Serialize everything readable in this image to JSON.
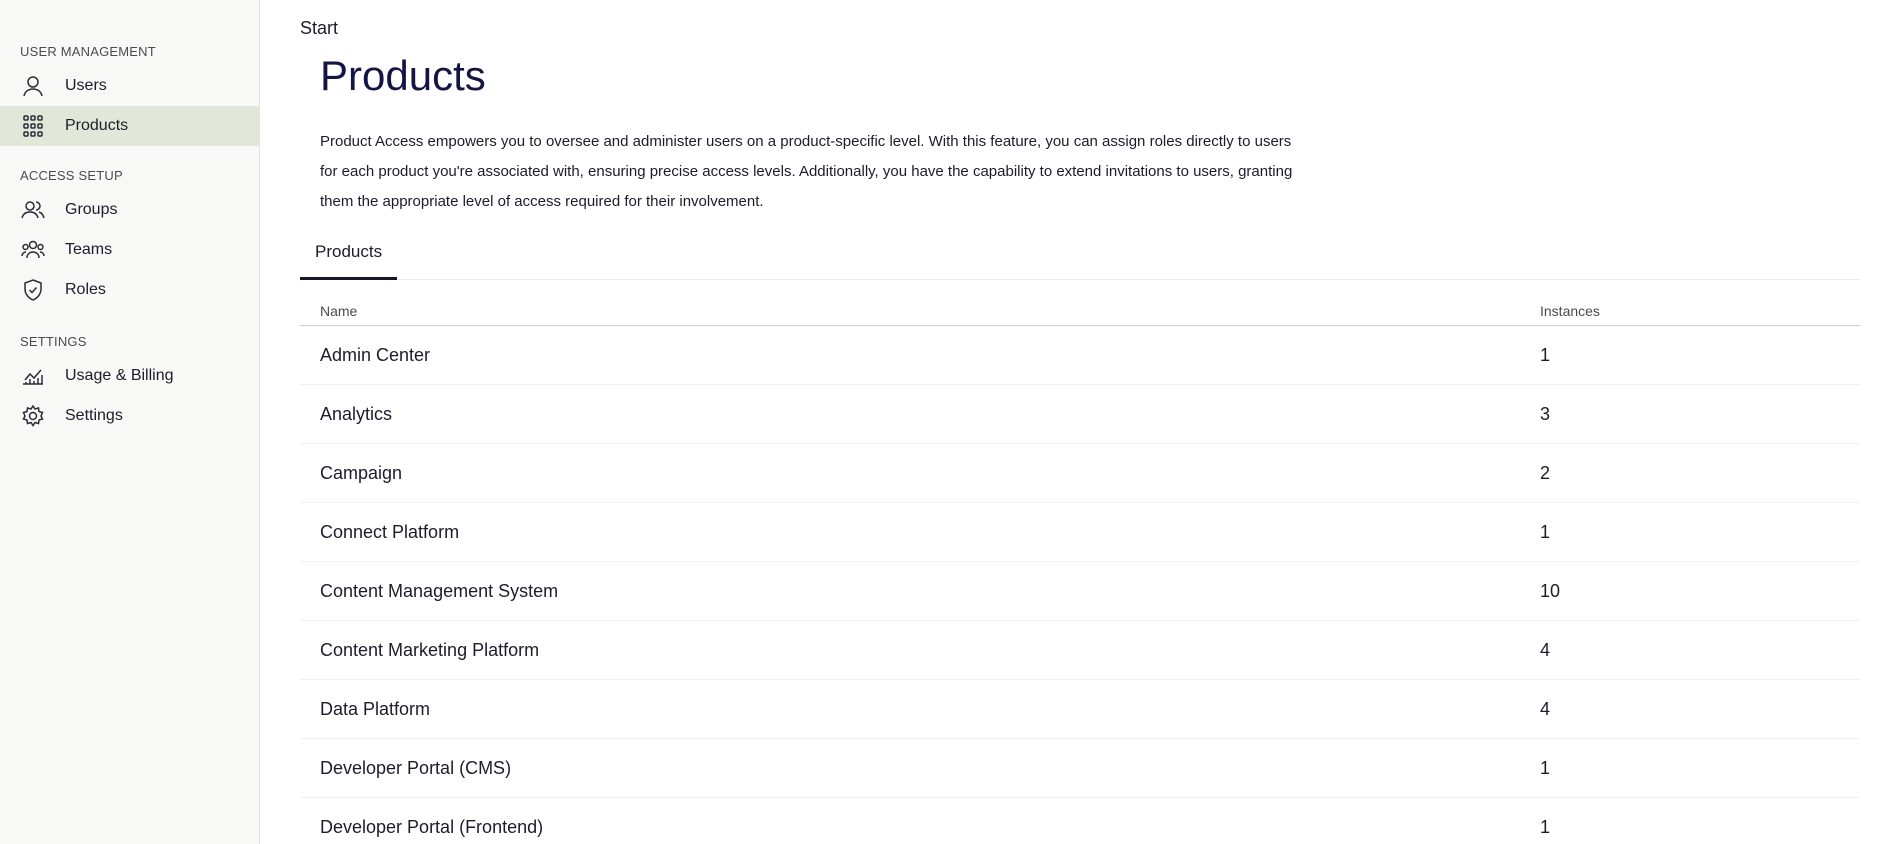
{
  "sidebar": {
    "sections": [
      {
        "title": "USER MANAGEMENT",
        "items": [
          {
            "label": "Users",
            "icon": "user-icon"
          },
          {
            "label": "Products",
            "icon": "grid-icon",
            "active": true
          }
        ]
      },
      {
        "title": "ACCESS SETUP",
        "items": [
          {
            "label": "Groups",
            "icon": "group-icon"
          },
          {
            "label": "Teams",
            "icon": "team-icon"
          },
          {
            "label": "Roles",
            "icon": "shield-icon"
          }
        ]
      },
      {
        "title": "SETTINGS",
        "items": [
          {
            "label": "Usage & Billing",
            "icon": "chart-icon"
          },
          {
            "label": "Settings",
            "icon": "gear-icon"
          }
        ]
      }
    ]
  },
  "breadcrumb": "Start",
  "page_title": "Products",
  "description": "Product Access empowers you to oversee and administer users on a product-specific level. With this feature, you can assign roles directly to users for each product you're associated with, ensuring precise access levels. Additionally, you have the capability to extend invitations to users, granting them the appropriate level of access required for their involvement.",
  "tabs": [
    {
      "label": "Products",
      "active": true
    }
  ],
  "table": {
    "columns": {
      "name": "Name",
      "instances": "Instances"
    },
    "rows": [
      {
        "name": "Admin Center",
        "instances": "1"
      },
      {
        "name": "Analytics",
        "instances": "3"
      },
      {
        "name": "Campaign",
        "instances": "2"
      },
      {
        "name": "Connect Platform",
        "instances": "1"
      },
      {
        "name": "Content Management System",
        "instances": "10"
      },
      {
        "name": "Content Marketing Platform",
        "instances": "4"
      },
      {
        "name": "Data Platform",
        "instances": "4"
      },
      {
        "name": "Developer Portal (CMS)",
        "instances": "1"
      },
      {
        "name": "Developer Portal (Frontend)",
        "instances": "1"
      }
    ]
  }
}
